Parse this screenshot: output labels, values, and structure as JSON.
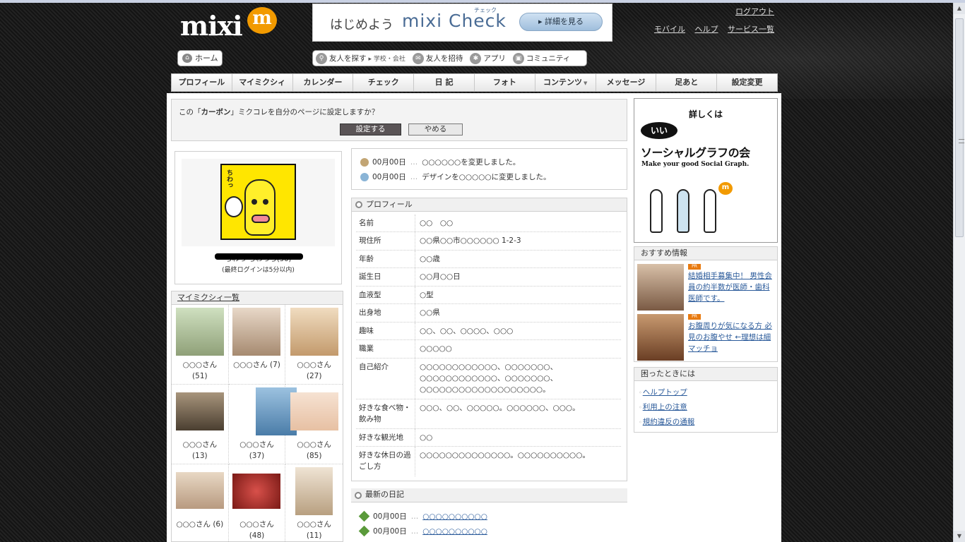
{
  "header": {
    "logo_text": "mixi",
    "logo_badge": "m",
    "banner": {
      "lead": "はじめよう",
      "brand": "mixi Check",
      "ruby": "チェック",
      "button": "詳細を見る"
    },
    "links": {
      "logout": "ログアウト",
      "mobile": "モバイル",
      "help": "ヘルプ",
      "services": "サービス一覧"
    }
  },
  "subnav": {
    "home": "ホーム",
    "find_friends": "友人を探す",
    "find_friends_sub": "▸ 学校・会社",
    "invite": "友人を招待",
    "apps": "アプリ",
    "community": "コミュニティ"
  },
  "mainnav": [
    {
      "label": "プロフィール"
    },
    {
      "label": "マイミクシィ"
    },
    {
      "label": "カレンダー"
    },
    {
      "label": "チェック"
    },
    {
      "label": "日 記"
    },
    {
      "label": "フォト"
    },
    {
      "label": "コンテンツ",
      "caret": "▼"
    },
    {
      "label": "メッセージ"
    },
    {
      "label": "足あと"
    },
    {
      "label": "設定変更"
    }
  ],
  "confirm": {
    "pre": "この「",
    "name": "カーボン",
    "post": "」ミクコレを自分のページに設定しますか？",
    "ok": "設定する",
    "cancel": "やめる"
  },
  "profile_card": {
    "art_label": "ちわっ",
    "name": "ちわっ ちわっち(50)",
    "last_login": "(最終ログインは5分以内)"
  },
  "mymixi": {
    "title": "マイミクシィ一覧",
    "friends": [
      {
        "name": "○○○さん",
        "count": "(51)",
        "color": "#8fa078"
      },
      {
        "name": "○○○さん",
        "count": "(7)",
        "color": "#a68a70"
      },
      {
        "name": "○○○さん",
        "count": "(27)",
        "color": "#c39a6c"
      },
      {
        "name": "○○○さん",
        "count": "(13)",
        "color": "#6a5a48"
      },
      {
        "name": "○○○さん",
        "count": "(37)",
        "color": "#4a7ca8"
      },
      {
        "name": "○○○さん",
        "count": "(85)",
        "color": "#e7c0a3"
      },
      {
        "name": "○○○さん",
        "count": "(6)",
        "color": "#b89a80"
      },
      {
        "name": "○○○さん",
        "count": "(48)",
        "color": "#b0302a"
      },
      {
        "name": "○○○さん",
        "count": "(11)",
        "color": "#d6c4a8"
      }
    ]
  },
  "activity": [
    {
      "date": "00月00日",
      "sep": "…",
      "text": "○○○○○○を変更しました。",
      "color": "#c2a574"
    },
    {
      "date": "00月00日",
      "sep": "…",
      "text": "デザインを○○○○○に変更しました。",
      "color": "#8ab4d6"
    }
  ],
  "profile": {
    "title": "プロフィール",
    "rows": [
      {
        "k": "名前",
        "v": "○○　○○"
      },
      {
        "k": "現住所",
        "v": "○○県○○市○○○○○○ 1-2-3"
      },
      {
        "k": "年齢",
        "v": "○○歳"
      },
      {
        "k": "誕生日",
        "v": "○○月○○日"
      },
      {
        "k": "血液型",
        "v": "○型"
      },
      {
        "k": "出身地",
        "v": "○○県"
      },
      {
        "k": "趣味",
        "v": "○○、○○、○○○○、○○○"
      },
      {
        "k": "職業",
        "v": "○○○○○"
      },
      {
        "k": "自己紹介",
        "v": "○○○○○○○○○○○○、○○○○○○○、○○○○○○○○○○○○、○○○○○○○、○○○○○○○○○○○○○○○○○○○。"
      },
      {
        "k": "好きな食べ物・飲み物",
        "v": "○○○、○○、○○○○○。○○○○○○、○○○。"
      },
      {
        "k": "好きな観光地",
        "v": "○○"
      },
      {
        "k": "好きな休日の過ごし方",
        "v": "○○○○○○○○○○○○○○。○○○○○○○○○○。"
      }
    ]
  },
  "diary": {
    "title": "最新の日記",
    "entries": [
      {
        "date": "00月00日",
        "sep": "…",
        "title": "○○○○○○○○○○"
      },
      {
        "date": "00月00日",
        "sep": "…",
        "title": "○○○○○○○○○○"
      }
    ]
  },
  "ad": {
    "line1": "詳しくは",
    "bubble": "いい",
    "line2": "ソーシャルグラフの会",
    "line3": "Make your good Social Graph.",
    "badge": "m"
  },
  "recommend": {
    "title": "おすすめ情報",
    "items": [
      {
        "badge": "PR",
        "text": "結婚相手募集中！ 男性会員の約半数が医師・歯科医師です。",
        "thumb_color": "#7a5a44"
      },
      {
        "badge": "PR",
        "text": "お腹周りが気になる方 必見のお腹やせ ←理想は細マッチョ",
        "thumb_color": "#8a5a3a"
      }
    ]
  },
  "help": {
    "title": "困ったときには",
    "links": [
      "ヘルプトップ",
      "利用上の注意",
      "規約違反の通報"
    ],
    "bullet": "◦"
  }
}
